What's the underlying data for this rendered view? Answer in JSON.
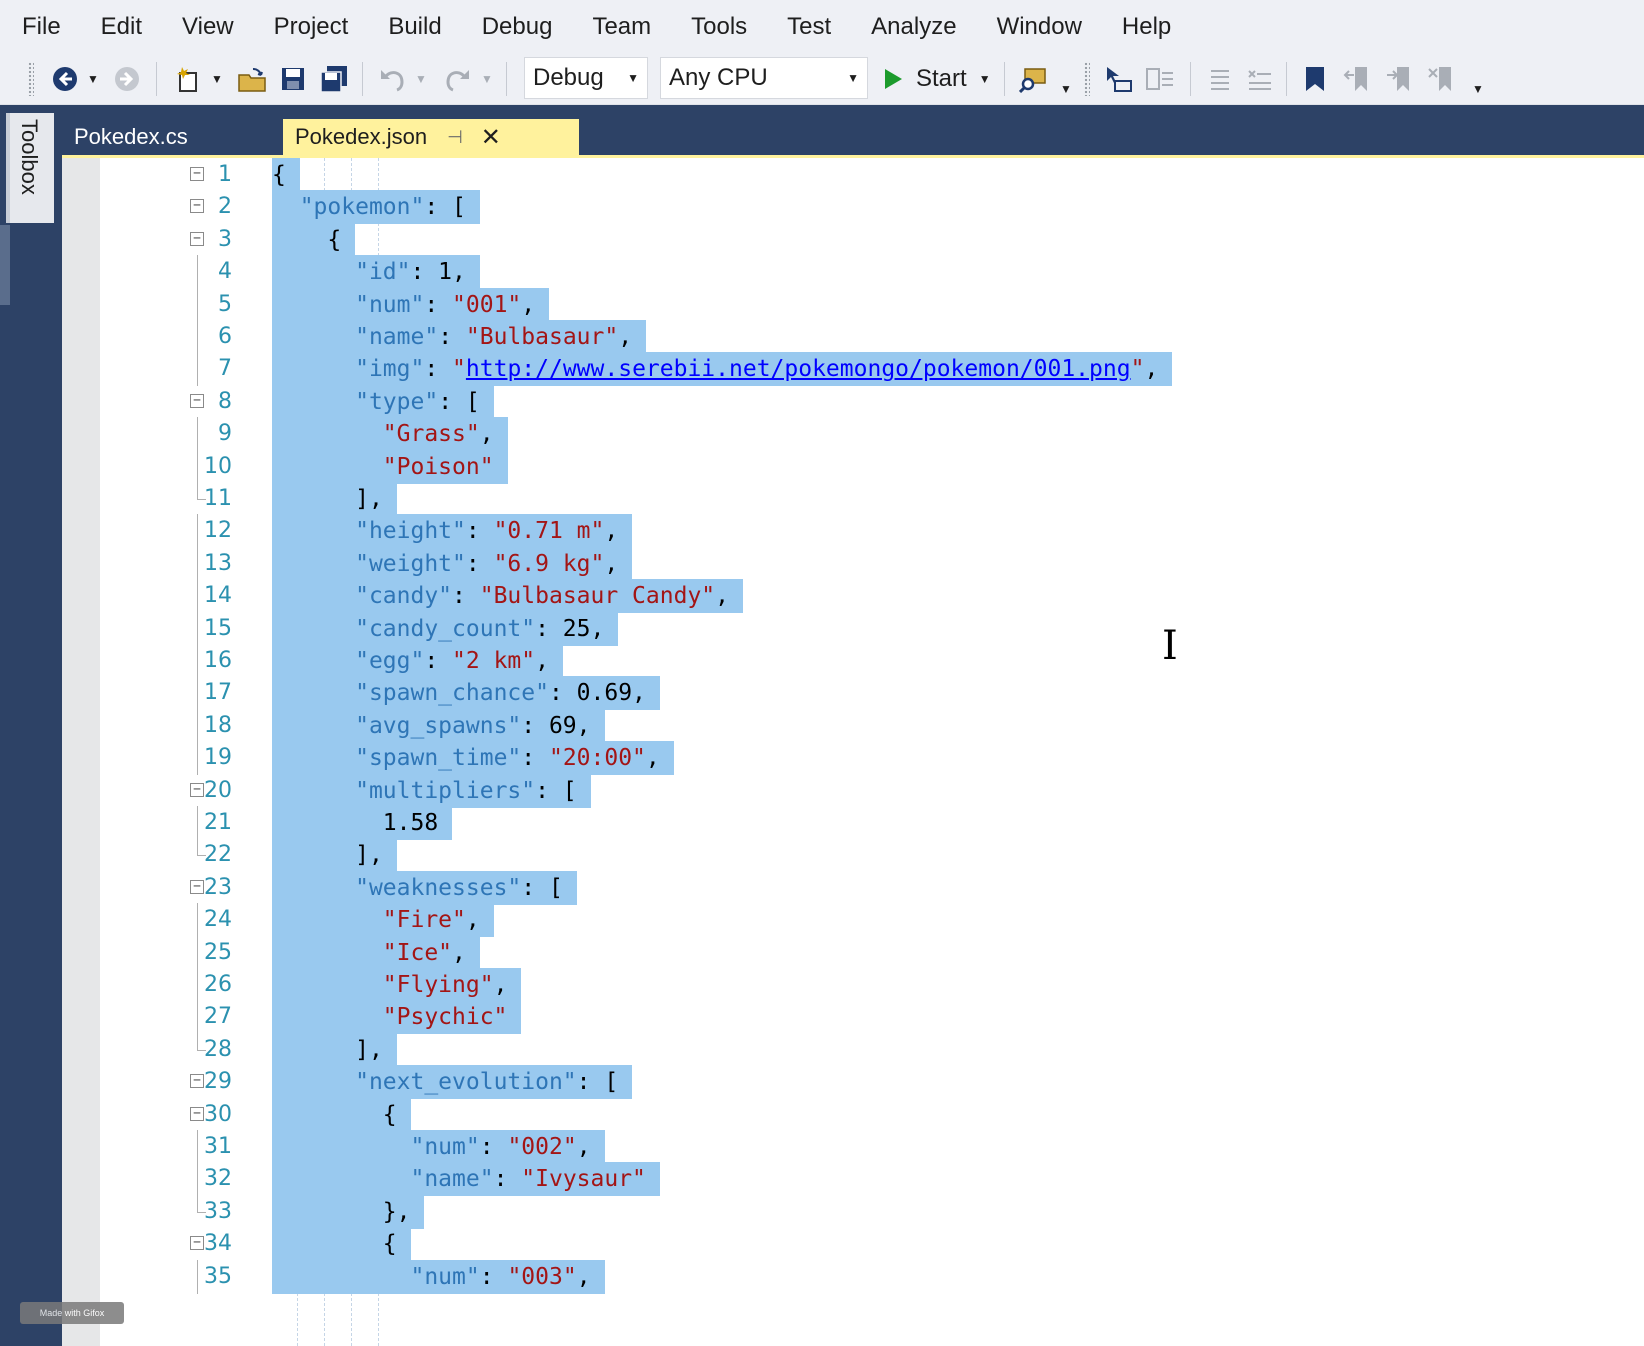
{
  "menu": [
    "File",
    "Edit",
    "View",
    "Project",
    "Build",
    "Debug",
    "Team",
    "Tools",
    "Test",
    "Analyze",
    "Window",
    "Help"
  ],
  "toolbar": {
    "configuration": "Debug",
    "platform": "Any CPU",
    "start_label": "Start"
  },
  "toolbox": {
    "label": "Toolbox"
  },
  "tabs": [
    {
      "label": "Pokedex.cs"
    },
    {
      "label": "Pokedex.json"
    }
  ],
  "colors": {
    "selection": "#99c9ef",
    "key": "#2e75b6",
    "string": "#a31515",
    "active_tab": "#fff29d",
    "line_number": "#2b91af"
  },
  "editor": {
    "lines": [
      {
        "n": "1",
        "fold": "open",
        "indent": 0,
        "tokens": [
          [
            "p",
            "{"
          ]
        ]
      },
      {
        "n": "2",
        "fold": "open",
        "indent": 1,
        "tokens": [
          [
            "k",
            "\"pokemon\""
          ],
          [
            "p",
            ": ["
          ]
        ]
      },
      {
        "n": "3",
        "fold": "open",
        "indent": 2,
        "tokens": [
          [
            "p",
            "{"
          ]
        ]
      },
      {
        "n": "4",
        "indent": 3,
        "tokens": [
          [
            "k",
            "\"id\""
          ],
          [
            "p",
            ": 1,"
          ]
        ]
      },
      {
        "n": "5",
        "indent": 3,
        "tokens": [
          [
            "k",
            "\"num\""
          ],
          [
            "p",
            ": "
          ],
          [
            "s",
            "\"001\""
          ],
          [
            "p",
            ","
          ]
        ]
      },
      {
        "n": "6",
        "indent": 3,
        "tokens": [
          [
            "k",
            "\"name\""
          ],
          [
            "p",
            ": "
          ],
          [
            "s",
            "\"Bulbasaur\""
          ],
          [
            "p",
            ","
          ]
        ]
      },
      {
        "n": "7",
        "indent": 3,
        "tokens": [
          [
            "k",
            "\"img\""
          ],
          [
            "p",
            ": "
          ],
          [
            "s",
            "\""
          ],
          [
            "u",
            "http://www.serebii.net/pokemongo/pokemon/001.png"
          ],
          [
            "s",
            "\""
          ],
          [
            "p",
            ","
          ]
        ]
      },
      {
        "n": "8",
        "fold": "open",
        "indent": 3,
        "tokens": [
          [
            "k",
            "\"type\""
          ],
          [
            "p",
            ": ["
          ]
        ]
      },
      {
        "n": "9",
        "indent": 4,
        "tokens": [
          [
            "s",
            "\"Grass\""
          ],
          [
            "p",
            ","
          ]
        ]
      },
      {
        "n": "10",
        "indent": 4,
        "tokens": [
          [
            "s",
            "\"Poison\""
          ]
        ]
      },
      {
        "n": "11",
        "fold": "end",
        "indent": 3,
        "tokens": [
          [
            "p",
            "],"
          ]
        ]
      },
      {
        "n": "12",
        "indent": 3,
        "tokens": [
          [
            "k",
            "\"height\""
          ],
          [
            "p",
            ": "
          ],
          [
            "s",
            "\"0.71 m\""
          ],
          [
            "p",
            ","
          ]
        ]
      },
      {
        "n": "13",
        "indent": 3,
        "tokens": [
          [
            "k",
            "\"weight\""
          ],
          [
            "p",
            ": "
          ],
          [
            "s",
            "\"6.9 kg\""
          ],
          [
            "p",
            ","
          ]
        ]
      },
      {
        "n": "14",
        "indent": 3,
        "tokens": [
          [
            "k",
            "\"candy\""
          ],
          [
            "p",
            ": "
          ],
          [
            "s",
            "\"Bulbasaur Candy\""
          ],
          [
            "p",
            ","
          ]
        ]
      },
      {
        "n": "15",
        "indent": 3,
        "tokens": [
          [
            "k",
            "\"candy_count\""
          ],
          [
            "p",
            ": 25,"
          ]
        ]
      },
      {
        "n": "16",
        "indent": 3,
        "tokens": [
          [
            "k",
            "\"egg\""
          ],
          [
            "p",
            ": "
          ],
          [
            "s",
            "\"2 km\""
          ],
          [
            "p",
            ","
          ]
        ]
      },
      {
        "n": "17",
        "indent": 3,
        "tokens": [
          [
            "k",
            "\"spawn_chance\""
          ],
          [
            "p",
            ": 0.69,"
          ]
        ]
      },
      {
        "n": "18",
        "indent": 3,
        "tokens": [
          [
            "k",
            "\"avg_spawns\""
          ],
          [
            "p",
            ": 69,"
          ]
        ]
      },
      {
        "n": "19",
        "indent": 3,
        "tokens": [
          [
            "k",
            "\"spawn_time\""
          ],
          [
            "p",
            ": "
          ],
          [
            "s",
            "\"20:00\""
          ],
          [
            "p",
            ","
          ]
        ]
      },
      {
        "n": "20",
        "fold": "open",
        "indent": 3,
        "tokens": [
          [
            "k",
            "\"multipliers\""
          ],
          [
            "p",
            ": ["
          ]
        ]
      },
      {
        "n": "21",
        "indent": 4,
        "tokens": [
          [
            "p",
            "1.58"
          ]
        ]
      },
      {
        "n": "22",
        "fold": "end",
        "indent": 3,
        "tokens": [
          [
            "p",
            "],"
          ]
        ]
      },
      {
        "n": "23",
        "fold": "open",
        "indent": 3,
        "tokens": [
          [
            "k",
            "\"weaknesses\""
          ],
          [
            "p",
            ": ["
          ]
        ]
      },
      {
        "n": "24",
        "indent": 4,
        "tokens": [
          [
            "s",
            "\"Fire\""
          ],
          [
            "p",
            ","
          ]
        ]
      },
      {
        "n": "25",
        "indent": 4,
        "tokens": [
          [
            "s",
            "\"Ice\""
          ],
          [
            "p",
            ","
          ]
        ]
      },
      {
        "n": "26",
        "indent": 4,
        "tokens": [
          [
            "s",
            "\"Flying\""
          ],
          [
            "p",
            ","
          ]
        ]
      },
      {
        "n": "27",
        "indent": 4,
        "tokens": [
          [
            "s",
            "\"Psychic\""
          ]
        ]
      },
      {
        "n": "28",
        "fold": "end",
        "indent": 3,
        "tokens": [
          [
            "p",
            "],"
          ]
        ]
      },
      {
        "n": "29",
        "fold": "open",
        "indent": 3,
        "tokens": [
          [
            "k",
            "\"next_evolution\""
          ],
          [
            "p",
            ": ["
          ]
        ]
      },
      {
        "n": "30",
        "fold": "open",
        "indent": 4,
        "tokens": [
          [
            "p",
            "{"
          ]
        ]
      },
      {
        "n": "31",
        "indent": 5,
        "tokens": [
          [
            "k",
            "\"num\""
          ],
          [
            "p",
            ": "
          ],
          [
            "s",
            "\"002\""
          ],
          [
            "p",
            ","
          ]
        ]
      },
      {
        "n": "32",
        "indent": 5,
        "tokens": [
          [
            "k",
            "\"name\""
          ],
          [
            "p",
            ": "
          ],
          [
            "s",
            "\"Ivysaur\""
          ]
        ]
      },
      {
        "n": "33",
        "fold": "end",
        "indent": 4,
        "tokens": [
          [
            "p",
            "},"
          ]
        ]
      },
      {
        "n": "34",
        "fold": "open",
        "indent": 4,
        "tokens": [
          [
            "p",
            "{"
          ]
        ]
      },
      {
        "n": "35",
        "indent": 5,
        "tokens": [
          [
            "k",
            "\"num\""
          ],
          [
            "p",
            ": "
          ],
          [
            "s",
            "\"003\""
          ],
          [
            "p",
            ","
          ]
        ]
      }
    ]
  },
  "watermark": "Made with Gifox"
}
